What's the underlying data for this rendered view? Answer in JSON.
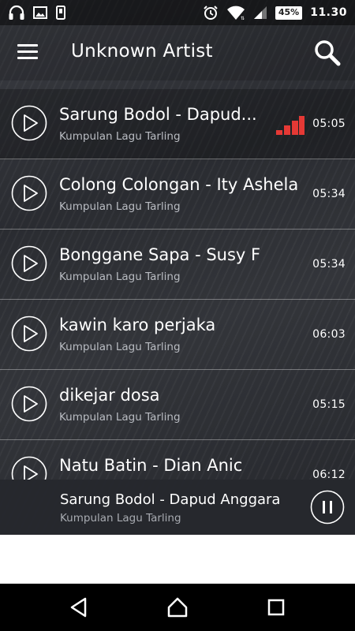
{
  "status_bar": {
    "icons_left": [
      "headphones-icon",
      "image-icon",
      "phone-notification-icon"
    ],
    "icons_right": [
      "alarm-icon",
      "wifi-icon",
      "signal-icon"
    ],
    "battery": "45%",
    "time": "11.30"
  },
  "app_bar": {
    "title": "Unknown Artist",
    "menu_icon": "hamburger-menu-icon",
    "search_icon": "search-icon"
  },
  "songs": [
    {
      "title": "Sarung Bodol - Dapud...",
      "subtitle": "Kumpulan Lagu Tarling",
      "duration": "05:05",
      "playing": true
    },
    {
      "title": "Colong Colongan - Ity Ashela",
      "subtitle": "Kumpulan Lagu Tarling",
      "duration": "05:34",
      "playing": false
    },
    {
      "title": "Bonggane Sapa - Susy F",
      "subtitle": "Kumpulan Lagu Tarling",
      "duration": "05:34",
      "playing": false
    },
    {
      "title": "kawin karo perjaka",
      "subtitle": "Kumpulan Lagu Tarling",
      "duration": "06:03",
      "playing": false
    },
    {
      "title": "dikejar dosa",
      "subtitle": "Kumpulan Lagu Tarling",
      "duration": "05:15",
      "playing": false
    },
    {
      "title": "Natu Batin - Dian Anic",
      "subtitle": "",
      "duration": "06:12",
      "playing": false
    }
  ],
  "now_playing": {
    "title": "Sarung Bodol - Dapud Anggara",
    "subtitle": "Kumpulan Lagu Tarling",
    "control_icon": "pause-icon"
  },
  "nav_bar": {
    "icons": [
      "back-icon",
      "home-icon",
      "recent-apps-icon"
    ]
  },
  "colors": {
    "accent_eq": "#e53935",
    "background": "#2e3035"
  }
}
